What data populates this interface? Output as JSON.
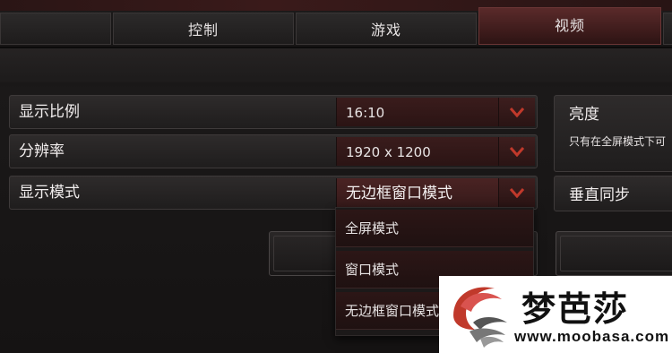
{
  "tabs": [
    {
      "label": ""
    },
    {
      "label": "控制"
    },
    {
      "label": "游戏"
    },
    {
      "label": "视频",
      "active": true
    }
  ],
  "settings": {
    "aspect_ratio": {
      "label": "显示比例",
      "value": "16:10"
    },
    "resolution": {
      "label": "分辨率",
      "value": "1920 x 1200"
    },
    "display_mode": {
      "label": "显示模式",
      "value": "无边框窗口模式"
    }
  },
  "display_mode_options": [
    "全屏模式",
    "窗口模式",
    "无边框窗口模式"
  ],
  "side_panels": {
    "brightness": {
      "title": "亮度",
      "note": "只有在全屏模式下可"
    },
    "vsync": {
      "title": "垂直同步"
    }
  },
  "watermark": {
    "brand": "梦芭莎",
    "url": "www.moobasa.com"
  },
  "icons": {
    "dropdown_arrow": "chevron-down-icon",
    "logo": "moobasa-logo-icon"
  },
  "colors": {
    "accent_red": "#c0392b",
    "active_tab": "#5a2a2a",
    "panel": "#2e2b2b"
  }
}
